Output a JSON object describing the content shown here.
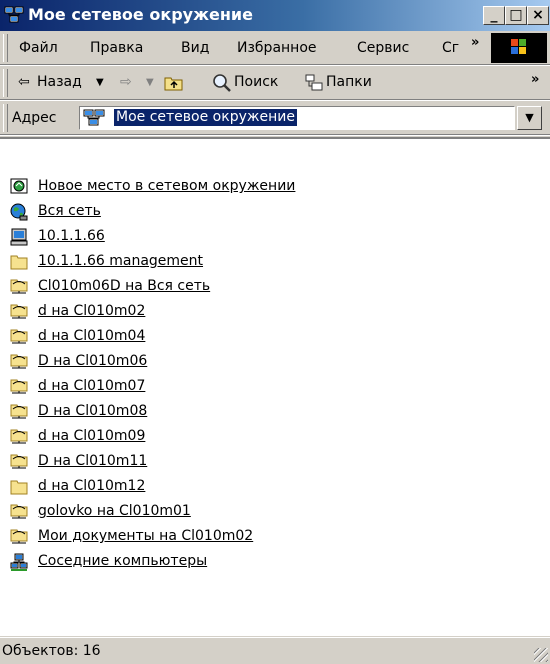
{
  "window": {
    "title": "Мое сетевое окружение"
  },
  "titlebar": {
    "min": "_",
    "max": "□",
    "close": "×"
  },
  "menu": {
    "items": [
      "Файл",
      "Правка",
      "Вид",
      "Избранное",
      "Сервис",
      "Сг"
    ],
    "more": "»"
  },
  "toolbar": {
    "back": "Назад",
    "search": "Поиск",
    "folders": "Папки",
    "more": "»"
  },
  "address": {
    "label": "Адрес",
    "value": "Мое сетевое окружение"
  },
  "items": [
    {
      "label": "Новое место в сетевом окружении",
      "icon": "wizard-icon"
    },
    {
      "label": "Вся сеть",
      "icon": "globe-icon"
    },
    {
      "label": "10.1.1.66",
      "icon": "computer-icon"
    },
    {
      "label": "10.1.1.66 management",
      "icon": "folder-icon"
    },
    {
      "label": "Cl010m06D на Вся сеть",
      "icon": "network-folder-icon"
    },
    {
      "label": "d на Cl010m02",
      "icon": "network-folder-icon"
    },
    {
      "label": "d на Cl010m04",
      "icon": "network-folder-icon"
    },
    {
      "label": "D на Cl010m06",
      "icon": "network-folder-icon"
    },
    {
      "label": "d на Cl010m07",
      "icon": "network-folder-icon"
    },
    {
      "label": "D на Cl010m08",
      "icon": "network-folder-icon"
    },
    {
      "label": "d на Cl010m09",
      "icon": "network-folder-icon"
    },
    {
      "label": "D на Cl010m11",
      "icon": "network-folder-icon"
    },
    {
      "label": "d на Cl010m12",
      "icon": "folder-icon"
    },
    {
      "label": "golovko на Cl010m01",
      "icon": "network-folder-icon"
    },
    {
      "label": "Мои документы на Cl010m02",
      "icon": "network-folder-icon"
    },
    {
      "label": "Соседние компьютеры",
      "icon": "network-computers-icon"
    }
  ],
  "status": {
    "text": "Объектов: 16"
  }
}
